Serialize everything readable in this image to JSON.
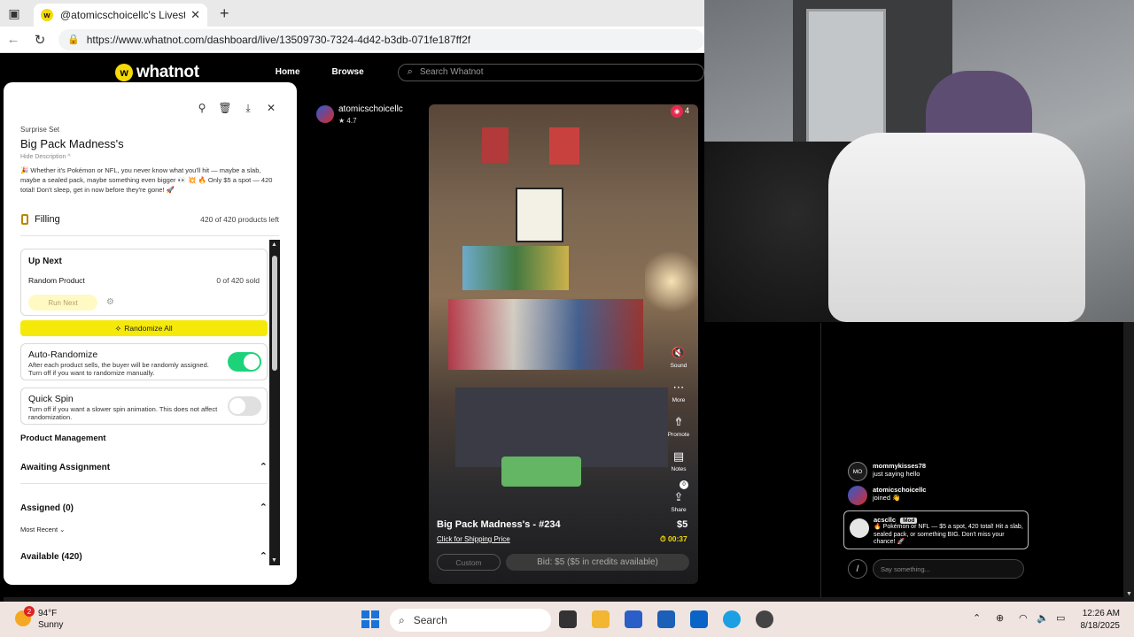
{
  "browser": {
    "tab_title": "@atomicschoicellc's Livestream o",
    "url": "https://www.whatnot.com/dashboard/live/13509730-7324-4d42-b3db-071fe187ff2f"
  },
  "header": {
    "logo": "whatnot",
    "logo_mark": "w",
    "nav_home": "Home",
    "nav_browse": "Browse",
    "search_placeholder": "Search Whatnot"
  },
  "panel": {
    "kind": "Surprise Set",
    "title": "Big Pack Madness's",
    "hide_description": "Hide Description ^",
    "description": "🎉 Whether it's Pokémon or NFL, you never know what you'll hit — maybe a slab, maybe a sealed pack, maybe something even bigger 👀 💥 🔥 Only $5 a spot — 420 total! Don't sleep, get in now before they're gone! 🚀",
    "filling_label": "Filling",
    "products_left": "420 of 420 products left",
    "up_next": {
      "heading": "Up Next",
      "product": "Random Product",
      "sold": "0 of 420 sold",
      "run_next": "Run Next"
    },
    "randomize_all": "Randomize All",
    "auto_randomize": {
      "title": "Auto-Randomize",
      "desc": "After each product sells, the buyer will be randomly assigned. Turn off if you want to randomize manually.",
      "on": true
    },
    "quick_spin": {
      "title": "Quick Spin",
      "desc": "Turn off if you want a slower spin animation. This does not affect randomization.",
      "on": false
    },
    "product_management": "Product Management",
    "awaiting_assignment": "Awaiting Assignment",
    "assigned": "Assigned (0)",
    "most_recent": "Most Recent ⌄",
    "available": "Available (420)"
  },
  "stream": {
    "seller": "atomicschoicellc",
    "rating": "★ 4.7",
    "viewers": "4",
    "controls": {
      "sound": "Sound",
      "more": "More",
      "promote": "Promote",
      "notes": "Notes",
      "notes_badge": "0",
      "share": "Share"
    },
    "product_title": "Big Pack Madness's - #234",
    "shipping_link": "Click for Shipping Price",
    "price": "$5",
    "timer": "00:37",
    "custom": "Custom",
    "bid": "Bid: $5 ($5 in credits available)"
  },
  "chat": {
    "messages": [
      {
        "avatar": "MO",
        "user": "mommykisses78",
        "text": "just saying hello"
      },
      {
        "avatar": "",
        "user": "atomicschoicellc",
        "text": "joined 👋"
      }
    ],
    "pinned": {
      "user": "acscllc",
      "badge": "Mod",
      "text": "🔥 Pokémon or NFL — $5 a spot, 420 total! Hit a slab, sealed pack, or something BIG. Don't miss your chance! 🚀"
    },
    "input_placeholder": "Say something..."
  },
  "taskbar": {
    "weather_badge": "2",
    "temp": "94°F",
    "condition": "Sunny",
    "search": "Search",
    "time": "12:26 AM",
    "date": "8/18/2025"
  }
}
